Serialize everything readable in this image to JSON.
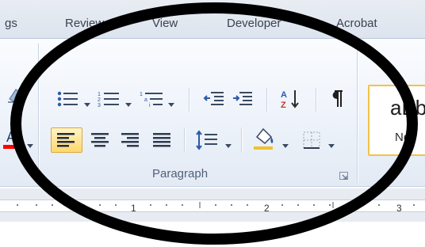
{
  "tabs": [
    {
      "label": "gs"
    },
    {
      "label": "Review"
    },
    {
      "label": "View"
    },
    {
      "label": "Developer"
    },
    {
      "label": "Acrobat"
    }
  ],
  "ribbon": {
    "paragraph_group_label": "Paragraph"
  },
  "styles": {
    "sample_text": "aBb",
    "style_name": "Nor"
  },
  "ruler": {
    "numbers": [
      "1",
      "2",
      "3"
    ]
  },
  "icons": {
    "bullets": "bullets-icon",
    "numbering": "numbering-icon",
    "multilevel": "multilevel-list-icon",
    "decrease_indent": "decrease-indent-icon",
    "increase_indent": "increase-indent-icon",
    "sort": "sort-icon",
    "show_marks": "pilcrow-icon",
    "align_left": "align-left-icon",
    "center": "align-center-icon",
    "align_right": "align-right-icon",
    "justify": "justify-icon",
    "line_spacing": "line-spacing-icon",
    "shading": "shading-icon",
    "borders": "borders-icon"
  },
  "colors": {
    "annotation": "#000000",
    "active_button": "#ffd86a",
    "font_color_bar": "#ff0000",
    "icon_blue": "#2a5aa8"
  }
}
